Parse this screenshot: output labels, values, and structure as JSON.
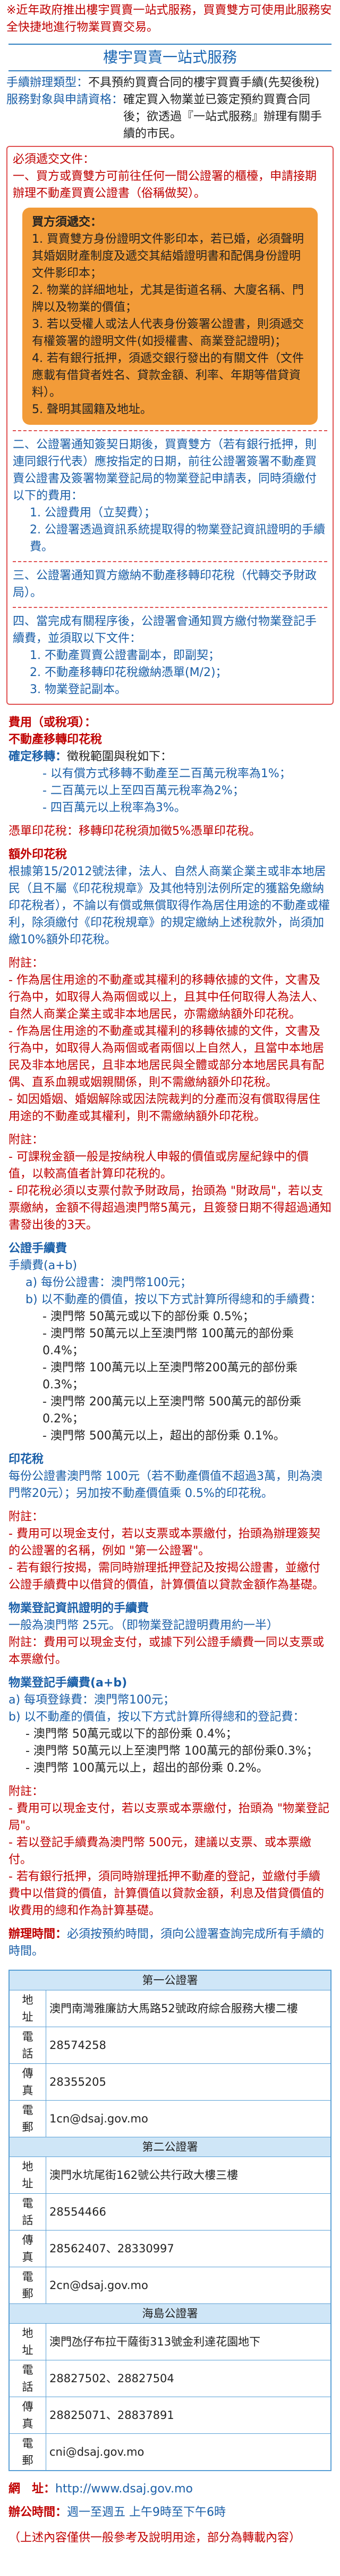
{
  "notice": "※近年政府推出樓宇買賣一站式服務，買賣雙方可使用此服務安全快捷地進行物業買賣交易。",
  "title": "樓宇買賣一站式服務",
  "intro": {
    "processing_label": "手續辦理類型：",
    "processing_value": "不具預約買賣合同的樓宇買賣手續(先契後稅)",
    "target_label": "服務對象與申請資格：",
    "target_value": "確定買入物業並已簽定預約買賣合同後；欲透過『一站式服務』辦理有關手續的市民。"
  },
  "prep_heading": "必須遞交文件：",
  "prep_intro": "一、買方或賣雙方可前往任何一間公證署的櫃檯，申請接期辦理不動產買賣公證書（俗稱做契）。",
  "buyer_box": {
    "heading": "買方須遞交：",
    "items": [
      "1. 買賣雙方身份證明文件影印本，若已婚，必須聲明其婚姻財產制度及遞交其結婚證明書和配偶身份證明文件影印本；",
      "2. 物業的詳細地址，尤其是街道名稱、大廈名稱、門牌以及物業的價值；",
      "3. 若以受權人或法人代表身份簽署公證書，則須遞交有權簽署的證明文件(如授權書、商業登記證明)；",
      "4. 若有銀行抵押，須遞交銀行發出的有關文件（文件應載有借貸者姓名、貸款金額、利率、年期等借貸資料）。",
      "5. 聲明其國籍及地址。"
    ]
  },
  "step2": {
    "num": "二、",
    "text": "公證署通知簽契日期後，買賣雙方（若有銀行抵押，則連同銀行代表）應按指定的日期，前往公證署簽署不動產買賣公證書及簽署物業登記局的物業登記申請表，同時須繳付以下的費用：",
    "items": [
      "1. 公證費用（立契費）；",
      "2. 公證署透過資訊系統提取得的物業登記資訊證明的手續費。"
    ]
  },
  "step3": {
    "num": "三、",
    "text": "公證署通知買方繳納不動產移轉印花稅（代轉交予財政局）。"
  },
  "step4": {
    "num": "四、",
    "text": "當完成有關程序後，公證署會通知買方繳付物業登記手續費，並須取以下文件：",
    "items": [
      "1. 不動產買賣公證書副本，即副契；",
      "2. 不動產移轉印花稅繳納憑單(M/2)；",
      "3. 物業登記副本。"
    ]
  },
  "fees_heading": "費用（或稅項）：",
  "stamp_transfer": {
    "heading": "不動產移轉印花稅",
    "rate_label": "確定移轉：",
    "rate_value": "徵稅範圍與稅如下：",
    "rates": [
      "- 以有償方式移轉不動產至二百萬元稅率為1%；",
      "- 二百萬元以上至四百萬元稅率為2%；",
      "- 四百萬元以上稅率為3%。"
    ]
  },
  "surcharge": "憑單印花稅：移轉印花稅須加徵5%憑單印花稅。",
  "extra": {
    "heading": "額外印花稅",
    "text": "根據第15/2012號法律，法人、自然人商業企業主或非本地居民（且不屬《印花稅規章》及其他特別法例所定的獲豁免繳納印花稅者），不論以有償或無償取得作為居住用途的不動產或權利，除須繳付《印花稅規章》的規定繳納上述稅款外，尚須加繳10%額外印花稅。"
  },
  "appendix1": {
    "heading": "附註：",
    "items": [
      "- 作為居住用途的不動產或其權利的移轉依據的文件，文書及行為中，如取得人為兩個或以上，且其中任何取得人為法人、自然人商業企業主或非本地居民，亦需繳納額外印花稅。",
      "- 作為居住用途的不動產或其權利的移轉依據的文件，文書及行為中，如取得人為兩個或者兩個以上自然人，且當中本地居民及非本地居民，且非本地居民與全體或部分本地居民具有配偶、直系血親或姻親關係，則不需繳納額外印花稅。",
      "- 如因婚姻、婚姻解除或因法院裁判的分產而沒有償取得居住用途的不動產或其權利，則不需繳納額外印花稅。"
    ]
  },
  "appendix2": {
    "heading": "附註：",
    "items": [
      "- 可課稅金額一般是按納稅人申報的價值或房屋紀錄中的價值，以較高值者計算印花稅的。",
      "- 印花稅必須以支票付款予財政局，抬頭為 \"財政局\"，若以支票繳納，金額不得超過澳門幣5萬元，且簽發日期不得超過通知書發出後的3天。"
    ]
  },
  "notary_fee": {
    "heading": "公證手續費",
    "sub": "手續費(a+b)",
    "a": "a) 每份公證書：澳門幣100元；",
    "b": "b) 以不動產的價值，按以下方式計算所得總和的手續費：",
    "rates": [
      "- 澳門幣 50萬元或以下的部份乘 0.5%；",
      "- 澳門幣 50萬元以上至澳門幣 100萬元的部份乘 0.4%；",
      "- 澳門幣 100萬元以上至澳門幣200萬元的部份乘 0.3%；",
      "- 澳門幣 200萬元以上至澳門幣 500萬元的部份乘 0.2%；",
      "- 澳門幣 500萬元以上，超出的部份乘 0.1%。"
    ]
  },
  "stamp_duty": {
    "heading": "印花稅",
    "text": "每份公證書澳門幣 100元（若不動產價值不超過3萬，則為澳門幣20元）；另加按不動產價值乘 0.5%的印花稅。"
  },
  "appendix3": {
    "heading": "附註：",
    "items": [
      "- 費用可以現金支付，若以支票或本票繳付，抬頭為辦理簽契的公證署的名稱，例如 \"第一公證署\"。",
      "- 若有銀行按揭，需同時辦理抵押登記及按揭公證書，並繳付公證手續費中以借貸的價值，計算價值以貸款金額作為基礎。"
    ]
  },
  "registry_fee": {
    "heading": "物業登記資訊證明的手續費",
    "text": "一般為澳門幣 25元。（即物業登記證明費用約一半）",
    "note": "附註：費用可以現金支付，或據下列公證手續費一同以支票或本票繳付。"
  },
  "property_fee": {
    "heading": "物業登記手續費(a+b)",
    "a": "a) 每項登錄費：澳門幣100元；",
    "b": "b) 以不動產的價值，按以下方式計算所得總和的登記費：",
    "rates": [
      "- 澳門幣 50萬元或以下的部份乘 0.4%；",
      "- 澳門幣 50萬元以上至澳門幣 100萬元的部份乘0.3%；",
      "- 澳門幣 100萬元以上，超出的部份乘 0.2%。"
    ]
  },
  "appendix4": {
    "heading": "附註：",
    "items": [
      "- 費用可以現金支付，若以支票或本票繳付，抬頭為 \"物業登記局\"。",
      "- 若以登記手續費為澳門幣 500元，建議以支票、或本票繳付。",
      "- 若有銀行抵押，須同時辦理抵押不動產的登記，並繳付手續費中以借貸的價值，計算價值以貸款金額，利息及借貸價值的收費用的總和作為計算基礎。"
    ]
  },
  "office_intro_label": "辦理時間：",
  "office_intro": "必須按預約時間，須向公證署查詢完成所有手續的時間。",
  "offices": [
    {
      "name": "第一公證署",
      "address": "澳門南灣雅廉訪大馬路52號政府綜合服務大樓二樓",
      "tel": "28574258",
      "fax": "28355205",
      "email": "1cn@dsaj.gov.mo"
    },
    {
      "name": "第二公證署",
      "address": "澳門水坑尾街162號公共行政大樓三樓",
      "tel": "28554466",
      "fax": "28562407、28330997",
      "email": "2cn@dsaj.gov.mo"
    },
    {
      "name": "海島公證署",
      "address": "澳門氹仔布拉干薩街313號金利達花園地下",
      "tel": "28827502、28827504",
      "fax": "28825071、28837891",
      "email": "cni@dsaj.gov.mo"
    }
  ],
  "labels": {
    "address": "地　址",
    "tel": "電　話",
    "fax": "傳　真",
    "email": "電　郵"
  },
  "website_label": "網　址：",
  "website": "http://www.dsaj.gov.mo",
  "hours_label": "辦公時間：",
  "hours": "週一至週五 上午9時至下午6時",
  "footer": "（上述內容僅供一般參考及說明用途，部分為轉載內容）"
}
